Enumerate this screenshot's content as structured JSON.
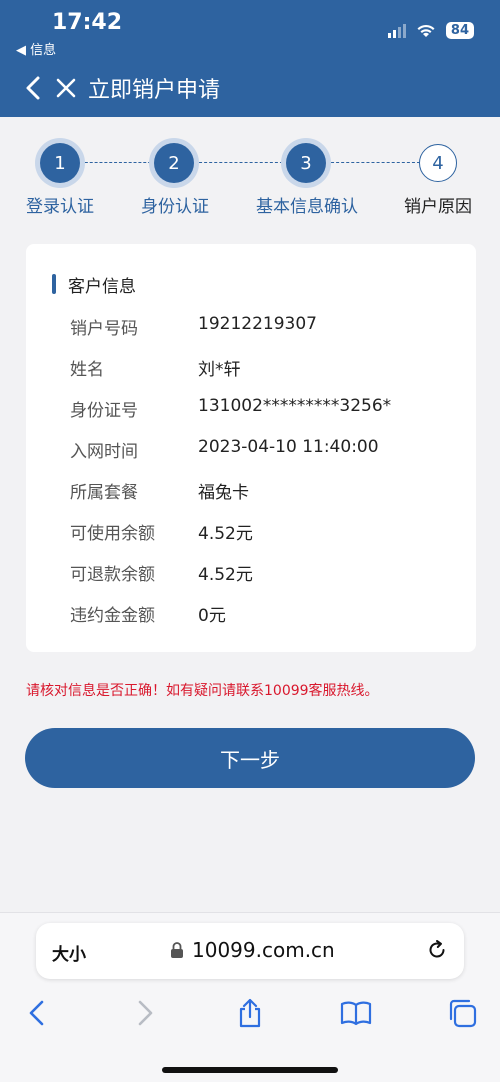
{
  "status": {
    "time": "17:42",
    "back_app": "◀ 信息",
    "battery": "84"
  },
  "header": {
    "title": "立即销户申请"
  },
  "steps": [
    {
      "num": "1",
      "label": "登录认证"
    },
    {
      "num": "2",
      "label": "身份认证"
    },
    {
      "num": "3",
      "label": "基本信息确认"
    },
    {
      "num": "4",
      "label": "销户原因"
    }
  ],
  "card": {
    "title": "客户信息",
    "rows": [
      {
        "key": "销户号码",
        "value": "19212219307"
      },
      {
        "key": "姓名",
        "value": "刘*轩"
      },
      {
        "key": "身份证号",
        "value": "131002*********3256*"
      },
      {
        "key": "入网时间",
        "value": "2023-04-10 11:40:00"
      },
      {
        "key": "所属套餐",
        "value": "福兔卡"
      },
      {
        "key": "可使用余额",
        "value": "4.52元"
      },
      {
        "key": "可退款余额",
        "value": "4.52元"
      },
      {
        "key": "违约金金额",
        "value": "0元"
      }
    ]
  },
  "warning": "请核对信息是否正确！如有疑问请联系10099客服热线。",
  "next_button": "下一步",
  "browser": {
    "aa": "大小",
    "url": "10099.com.cn"
  },
  "colors": {
    "primary": "#2e63a0",
    "warning": "#d9182d"
  }
}
